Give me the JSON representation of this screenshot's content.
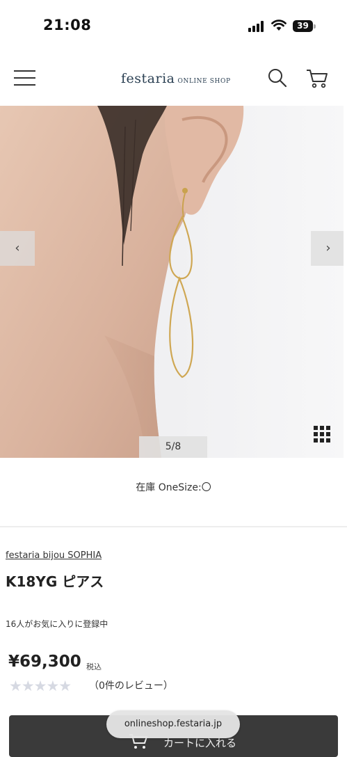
{
  "status_bar": {
    "time": "21:08",
    "battery": "39",
    "icons": [
      "signal-icon",
      "wifi-icon",
      "battery-icon"
    ]
  },
  "header": {
    "logo_main": "festaria",
    "logo_sub": "ONLINE SHOP",
    "icons": [
      "menu-icon",
      "search-icon",
      "cart-icon"
    ]
  },
  "gallery": {
    "prev_label": "‹",
    "next_label": "›",
    "counter": "5/8",
    "icons": [
      "grid-view-icon"
    ]
  },
  "product": {
    "stock": "在庫 OneSize:〇",
    "brand": "festaria bijou SOPHIA",
    "name": "K18YG ピアス",
    "favorites": "16人がお気に入りに登録中",
    "price": "¥69,300",
    "tax_label": "税込",
    "rating_stars": 0,
    "rating_max": 5,
    "stars_display": "★★★★★",
    "reviews": "（0件のレビュー）",
    "cart_button": "カートに入れる"
  },
  "browser": {
    "url": "onlineshop.festaria.jp"
  },
  "colors": {
    "logo": "#2a3f52",
    "cart_button_bg": "#3a3a3a",
    "star_empty": "#d6d9e2"
  }
}
